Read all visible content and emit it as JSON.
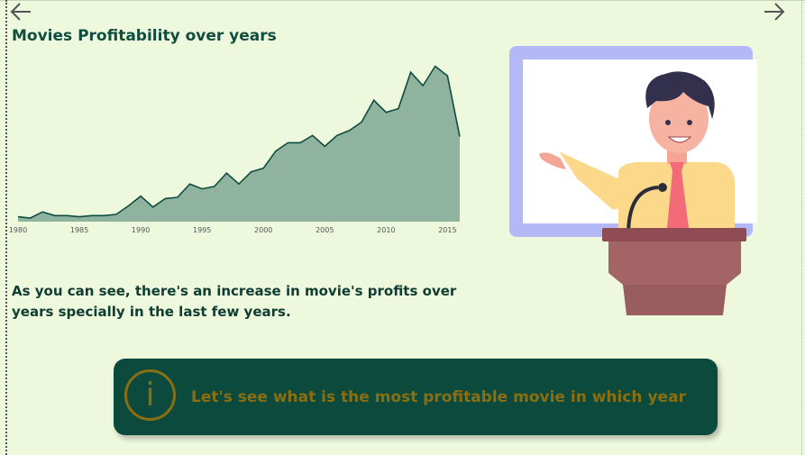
{
  "page": {
    "title": "Movies Profitability over years",
    "description": "As you can see, there's an increase in movie's profits over years specially in the last few years.",
    "callout_text": "Let's see what is the most profitable movie in which year",
    "callout_icon_glyph": "i"
  },
  "icons": {
    "back": "arrow-left-icon",
    "forward": "arrow-right-icon",
    "info": "info-icon",
    "illustration": "presenter-illustration"
  },
  "colors": {
    "background": "#eef8dc",
    "title": "#0f4d40",
    "area_fill": "#8fb39e",
    "area_stroke": "#0f4d40",
    "callout_bg": "#0b4a3d",
    "callout_accent": "#8a6f12"
  },
  "chart_data": {
    "type": "area",
    "title": "",
    "xlabel": "",
    "ylabel": "",
    "xlim": [
      1980,
      2016
    ],
    "ylim": [
      0,
      1
    ],
    "grid": false,
    "x_ticks": [
      1980,
      1985,
      1990,
      1995,
      2000,
      2005,
      2010,
      2015
    ],
    "x_tick_labels": [
      "1980",
      "1985",
      "1990",
      "1995",
      "2000",
      "2005",
      "2010",
      "2015"
    ],
    "series": [
      {
        "name": "",
        "x": [
          1980,
          1981,
          1982,
          1983,
          1984,
          1985,
          1986,
          1987,
          1988,
          1989,
          1990,
          1991,
          1992,
          1993,
          1994,
          1995,
          1996,
          1997,
          1998,
          1999,
          2000,
          2001,
          2002,
          2003,
          2004,
          2005,
          2006,
          2007,
          2008,
          2009,
          2010,
          2011,
          2012,
          2013,
          2014,
          2015,
          2016
        ],
        "y": [
          0.04,
          0.03,
          0.08,
          0.05,
          0.05,
          0.04,
          0.05,
          0.05,
          0.06,
          0.13,
          0.21,
          0.12,
          0.19,
          0.2,
          0.31,
          0.27,
          0.29,
          0.4,
          0.31,
          0.41,
          0.44,
          0.58,
          0.65,
          0.65,
          0.71,
          0.62,
          0.71,
          0.75,
          0.82,
          1.0,
          0.9,
          0.93,
          1.23,
          1.12,
          1.28,
          1.2,
          0.7
        ]
      }
    ]
  }
}
